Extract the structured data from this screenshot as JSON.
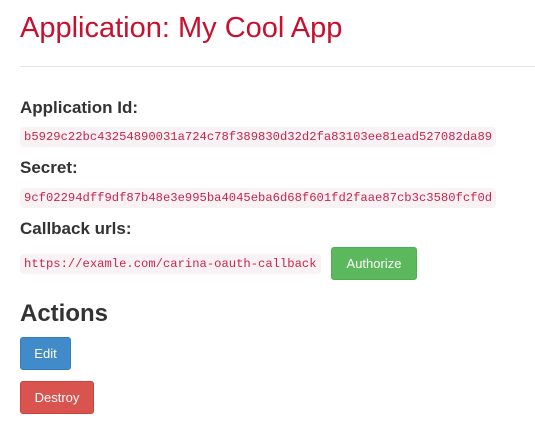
{
  "header": {
    "title": "Application: My Cool App"
  },
  "details": {
    "application_id_label": "Application Id:",
    "application_id_value": "b5929c22bc43254890031a724c78f389830d32d2fa83103ee81ead527082da89",
    "secret_label": "Secret:",
    "secret_value": "9cf02294dff9df87b48e3e995ba4045eba6d68f601fd2faae87cb3c3580fcf0d",
    "callback_label": "Callback urls:",
    "callback_value": "https://examle.com/carina-oauth-callback",
    "authorize_label": "Authorize"
  },
  "actions": {
    "heading": "Actions",
    "edit_label": "Edit",
    "destroy_label": "Destroy"
  },
  "colors": {
    "title": "#c7102e",
    "code_text": "#c7254e",
    "code_bg": "#f9f2f4",
    "success": "#5cb85c",
    "primary": "#428bca",
    "danger": "#d9534f"
  }
}
